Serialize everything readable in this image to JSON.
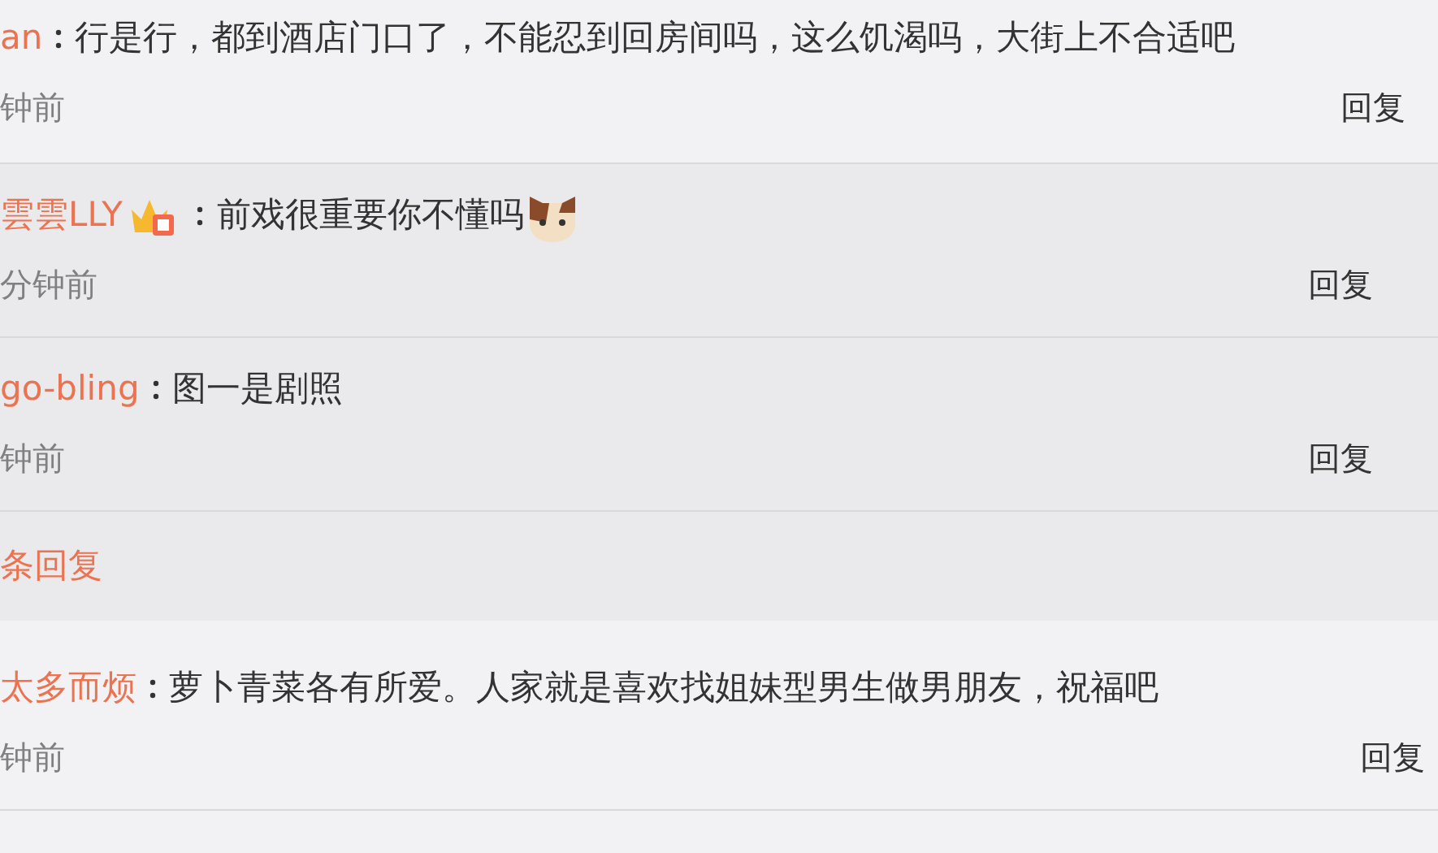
{
  "items": [
    {
      "kind": "comment",
      "user": "an",
      "text": "行是行，都到酒店门口了，不能忍到回房间吗，这么饥渴吗，大街上不合适吧",
      "time": "钟前",
      "reply": "回复"
    },
    {
      "kind": "subreply",
      "user": "雲雲LLY",
      "badge": true,
      "text": "前戏很重要你不懂吗",
      "emoji": true,
      "time": "分钟前",
      "reply": "回复"
    },
    {
      "kind": "subreply",
      "user": "go-bling",
      "badge": false,
      "text": "图一是剧照",
      "emoji": false,
      "time": "钟前",
      "reply": "回复"
    },
    {
      "kind": "more",
      "text": "条回复"
    },
    {
      "kind": "comment",
      "user": "太多而烦",
      "text": "萝卜青菜各有所爱。人家就是喜欢找姐妹型男生做男朋友，祝福吧",
      "time": "钟前",
      "reply": "回复"
    }
  ]
}
